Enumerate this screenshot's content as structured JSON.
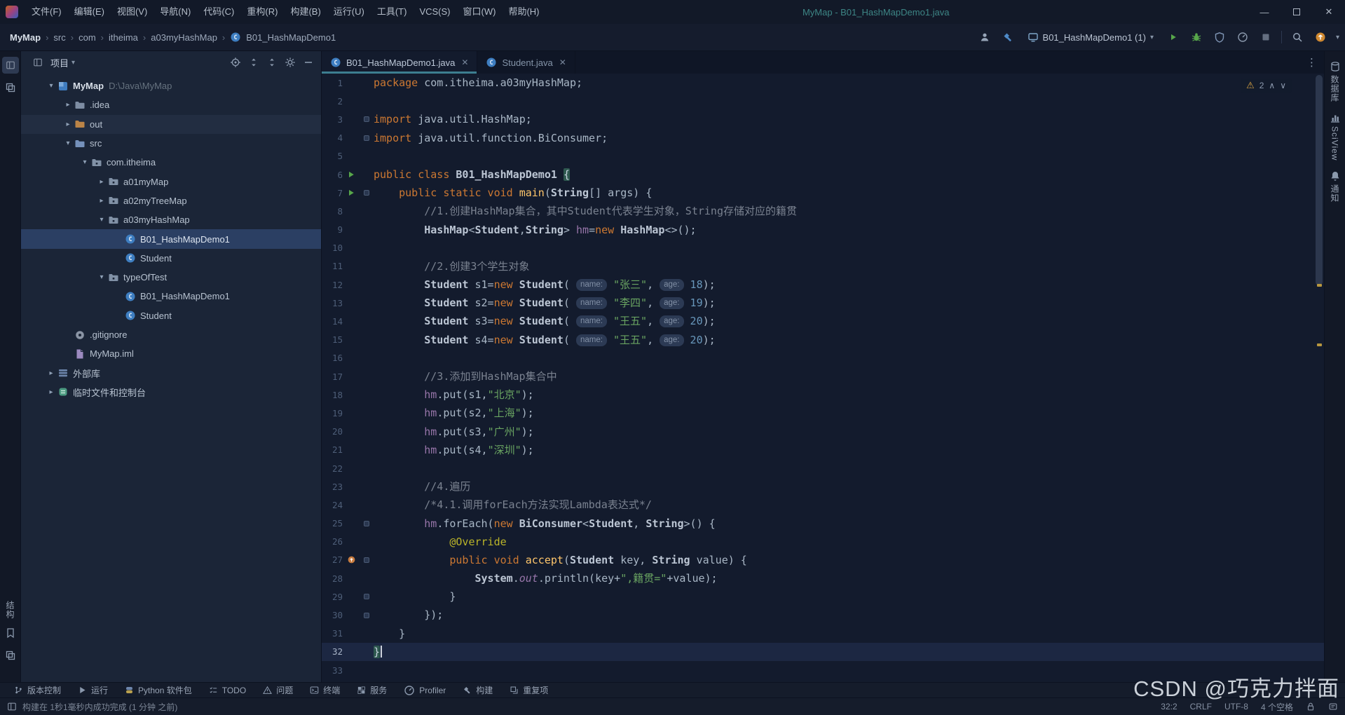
{
  "window": {
    "title": "MyMap - B01_HashMapDemo1.java"
  },
  "menubar": {
    "items": [
      "文件(F)",
      "编辑(E)",
      "视图(V)",
      "导航(N)",
      "代码(C)",
      "重构(R)",
      "构建(B)",
      "运行(U)",
      "工具(T)",
      "VCS(S)",
      "窗口(W)",
      "帮助(H)"
    ]
  },
  "navbar": {
    "breadcrumbs": [
      "MyMap",
      "src",
      "com",
      "itheima",
      "a03myHashMap",
      "B01_HashMapDemo1"
    ],
    "run_config": "B01_HashMapDemo1 (1)"
  },
  "project": {
    "header": "项目",
    "items": [
      {
        "label": "MyMap",
        "suffix": "D:\\Java\\MyMap",
        "level": 0,
        "chev": "open",
        "icon": "project",
        "bold": true
      },
      {
        "label": ".idea",
        "level": 1,
        "chev": "closed",
        "icon": "folder"
      },
      {
        "label": "out",
        "level": 1,
        "chev": "closed",
        "icon": "folder-out",
        "hover": true
      },
      {
        "label": "src",
        "level": 1,
        "chev": "open",
        "icon": "folder-src"
      },
      {
        "label": "com.itheima",
        "level": 2,
        "chev": "open",
        "icon": "package"
      },
      {
        "label": "a01myMap",
        "level": 3,
        "chev": "closed",
        "icon": "package"
      },
      {
        "label": "a02myTreeMap",
        "level": 3,
        "chev": "closed",
        "icon": "package"
      },
      {
        "label": "a03myHashMap",
        "level": 3,
        "chev": "open",
        "icon": "package"
      },
      {
        "label": "B01_HashMapDemo1",
        "level": 4,
        "chev": "none",
        "icon": "class",
        "selected": true
      },
      {
        "label": "Student",
        "level": 4,
        "chev": "none",
        "icon": "class"
      },
      {
        "label": "typeOfTest",
        "level": 3,
        "chev": "open",
        "icon": "package"
      },
      {
        "label": "B01_HashMapDemo1",
        "level": 4,
        "chev": "none",
        "icon": "class"
      },
      {
        "label": "Student",
        "level": 4,
        "chev": "none",
        "icon": "class"
      },
      {
        "label": ".gitignore",
        "level": 1,
        "chev": "none",
        "icon": "git"
      },
      {
        "label": "MyMap.iml",
        "level": 1,
        "chev": "none",
        "icon": "iml"
      },
      {
        "label": "外部库",
        "level": 0,
        "chev": "closed",
        "icon": "libs"
      },
      {
        "label": "临时文件和控制台",
        "level": 0,
        "chev": "closed",
        "icon": "scratch"
      }
    ]
  },
  "tabs": [
    {
      "label": "B01_HashMapDemo1.java",
      "active": true
    },
    {
      "label": "Student.java",
      "active": false
    }
  ],
  "editor": {
    "warning_count": "2",
    "lines": [
      {
        "n": 1,
        "t": [
          [
            "kw",
            "package "
          ],
          [
            "d",
            "com.itheima.a03myHashMap;"
          ]
        ]
      },
      {
        "n": 2,
        "t": []
      },
      {
        "n": 3,
        "fd": 1,
        "t": [
          [
            "kw",
            "import "
          ],
          [
            "d",
            "java.util.HashMap;"
          ]
        ]
      },
      {
        "n": 4,
        "fd": 1,
        "t": [
          [
            "kw",
            "import "
          ],
          [
            "d",
            "java.util.function.BiConsumer;"
          ]
        ]
      },
      {
        "n": 5,
        "t": []
      },
      {
        "n": 6,
        "g": "run",
        "t": [
          [
            "kw",
            "public class "
          ],
          [
            "c",
            "B01_HashMapDemo1 "
          ],
          [
            "bh",
            "{"
          ]
        ]
      },
      {
        "n": 7,
        "g": "run",
        "fd": 1,
        "t": [
          [
            "d",
            "    "
          ],
          [
            "kw",
            "public static void "
          ],
          [
            "fn",
            "main"
          ],
          [
            "d",
            "("
          ],
          [
            "c",
            "String"
          ],
          [
            "d",
            "[] args) {"
          ]
        ]
      },
      {
        "n": 8,
        "t": [
          [
            "d",
            "        "
          ],
          [
            "cm",
            "//1.创建HashMap集合，其中Student代表学生对象，String存储对应的籍贯"
          ]
        ]
      },
      {
        "n": 9,
        "t": [
          [
            "d",
            "        "
          ],
          [
            "c",
            "HashMap"
          ],
          [
            "d",
            "<"
          ],
          [
            "c",
            "Student"
          ],
          [
            "d",
            ","
          ],
          [
            "c",
            "String"
          ],
          [
            "d",
            "> "
          ],
          [
            "f",
            "hm"
          ],
          [
            "d",
            "="
          ],
          [
            "kw",
            "new "
          ],
          [
            "c",
            "HashMap"
          ],
          [
            "d",
            "<>();"
          ]
        ]
      },
      {
        "n": 10,
        "t": []
      },
      {
        "n": 11,
        "t": [
          [
            "d",
            "        "
          ],
          [
            "cm",
            "//2.创建3个学生对象"
          ]
        ]
      },
      {
        "n": 12,
        "t": [
          [
            "d",
            "        "
          ],
          [
            "c",
            "Student"
          ],
          [
            "d",
            " s1="
          ],
          [
            "kw",
            "new "
          ],
          [
            "c",
            "Student"
          ],
          [
            "d",
            "( "
          ],
          [
            "h",
            "name:"
          ],
          [
            "d",
            " "
          ],
          [
            "s",
            "\"张三\""
          ],
          [
            "d",
            ", "
          ],
          [
            "h",
            "age:"
          ],
          [
            "d",
            " "
          ],
          [
            "n",
            "18"
          ],
          [
            "d",
            ");"
          ]
        ]
      },
      {
        "n": 13,
        "t": [
          [
            "d",
            "        "
          ],
          [
            "c",
            "Student"
          ],
          [
            "d",
            " s2="
          ],
          [
            "kw",
            "new "
          ],
          [
            "c",
            "Student"
          ],
          [
            "d",
            "( "
          ],
          [
            "h",
            "name:"
          ],
          [
            "d",
            " "
          ],
          [
            "s",
            "\"李四\""
          ],
          [
            "d",
            ", "
          ],
          [
            "h",
            "age:"
          ],
          [
            "d",
            " "
          ],
          [
            "n",
            "19"
          ],
          [
            "d",
            ");"
          ]
        ]
      },
      {
        "n": 14,
        "t": [
          [
            "d",
            "        "
          ],
          [
            "c",
            "Student"
          ],
          [
            "d",
            " s3="
          ],
          [
            "kw",
            "new "
          ],
          [
            "c",
            "Student"
          ],
          [
            "d",
            "( "
          ],
          [
            "h",
            "name:"
          ],
          [
            "d",
            " "
          ],
          [
            "s",
            "\"王五\""
          ],
          [
            "d",
            ", "
          ],
          [
            "h",
            "age:"
          ],
          [
            "d",
            " "
          ],
          [
            "n",
            "20"
          ],
          [
            "d",
            ");"
          ]
        ]
      },
      {
        "n": 15,
        "t": [
          [
            "d",
            "        "
          ],
          [
            "c",
            "Student"
          ],
          [
            "d",
            " s4="
          ],
          [
            "kw",
            "new "
          ],
          [
            "c",
            "Student"
          ],
          [
            "d",
            "( "
          ],
          [
            "h",
            "name:"
          ],
          [
            "d",
            " "
          ],
          [
            "s",
            "\"王五\""
          ],
          [
            "d",
            ", "
          ],
          [
            "h",
            "age:"
          ],
          [
            "d",
            " "
          ],
          [
            "n",
            "20"
          ],
          [
            "d",
            ");"
          ]
        ]
      },
      {
        "n": 16,
        "t": []
      },
      {
        "n": 17,
        "t": [
          [
            "d",
            "        "
          ],
          [
            "cm",
            "//3.添加到HashMap集合中"
          ]
        ]
      },
      {
        "n": 18,
        "t": [
          [
            "d",
            "        "
          ],
          [
            "f",
            "hm"
          ],
          [
            "d",
            ".put(s1,"
          ],
          [
            "s",
            "\"北京\""
          ],
          [
            "d",
            ");"
          ]
        ]
      },
      {
        "n": 19,
        "t": [
          [
            "d",
            "        "
          ],
          [
            "f",
            "hm"
          ],
          [
            "d",
            ".put(s2,"
          ],
          [
            "s",
            "\"上海\""
          ],
          [
            "d",
            ");"
          ]
        ]
      },
      {
        "n": 20,
        "t": [
          [
            "d",
            "        "
          ],
          [
            "f",
            "hm"
          ],
          [
            "d",
            ".put(s3,"
          ],
          [
            "s",
            "\"广州\""
          ],
          [
            "d",
            ");"
          ]
        ]
      },
      {
        "n": 21,
        "t": [
          [
            "d",
            "        "
          ],
          [
            "f",
            "hm"
          ],
          [
            "d",
            ".put(s4,"
          ],
          [
            "s",
            "\"深圳\""
          ],
          [
            "d",
            ");"
          ]
        ]
      },
      {
        "n": 22,
        "t": []
      },
      {
        "n": 23,
        "t": [
          [
            "d",
            "        "
          ],
          [
            "cm",
            "//4.遍历"
          ]
        ]
      },
      {
        "n": 24,
        "t": [
          [
            "d",
            "        "
          ],
          [
            "cm",
            "/*4.1.调用forEach方法实现Lambda表达式*/"
          ]
        ]
      },
      {
        "n": 25,
        "fd": 1,
        "t": [
          [
            "d",
            "        "
          ],
          [
            "f",
            "hm"
          ],
          [
            "d",
            ".forEach("
          ],
          [
            "kw",
            "new "
          ],
          [
            "c",
            "BiConsumer"
          ],
          [
            "d",
            "<"
          ],
          [
            "c",
            "Student"
          ],
          [
            "d",
            ", "
          ],
          [
            "c",
            "String"
          ],
          [
            "d",
            ">() {"
          ]
        ]
      },
      {
        "n": 26,
        "t": [
          [
            "d",
            "            "
          ],
          [
            "an",
            "@Override"
          ]
        ]
      },
      {
        "n": 27,
        "g": "ovr",
        "fd": 1,
        "t": [
          [
            "d",
            "            "
          ],
          [
            "kw",
            "public void "
          ],
          [
            "fn",
            "accept"
          ],
          [
            "d",
            "("
          ],
          [
            "c",
            "Student"
          ],
          [
            "d",
            " key, "
          ],
          [
            "c",
            "String"
          ],
          [
            "d",
            " value) {"
          ]
        ]
      },
      {
        "n": 28,
        "t": [
          [
            "d",
            "                "
          ],
          [
            "c",
            "System"
          ],
          [
            "d",
            "."
          ],
          [
            "st",
            "out"
          ],
          [
            "d",
            ".println(key+"
          ],
          [
            "s",
            "\",籍贯=\""
          ],
          [
            "d",
            "+value);"
          ]
        ]
      },
      {
        "n": 29,
        "fd": 1,
        "t": [
          [
            "d",
            "            }"
          ]
        ]
      },
      {
        "n": 30,
        "fd": 1,
        "t": [
          [
            "d",
            "        });"
          ]
        ]
      },
      {
        "n": 31,
        "t": [
          [
            "d",
            "    }"
          ]
        ]
      },
      {
        "n": 32,
        "cur": 1,
        "crt": 1,
        "t": [
          [
            "bh",
            "}"
          ]
        ]
      },
      {
        "n": 33,
        "t": []
      }
    ]
  },
  "left_stripe": {
    "bottom_label": "结构"
  },
  "right_stripe": {
    "items": [
      "数据库",
      "SciView",
      "通知"
    ]
  },
  "bottom_toolbar": {
    "items": [
      {
        "icon": "vcs",
        "label": "版本控制"
      },
      {
        "icon": "playg",
        "label": "运行"
      },
      {
        "icon": "python",
        "label": "Python 软件包"
      },
      {
        "icon": "todo",
        "label": "TODO"
      },
      {
        "icon": "problems",
        "label": "问题"
      },
      {
        "icon": "terminal",
        "label": "终端"
      },
      {
        "icon": "services",
        "label": "服务"
      },
      {
        "icon": "gauge",
        "label": "Profiler"
      },
      {
        "icon": "build",
        "label": "构建"
      },
      {
        "icon": "dup",
        "label": "重复项"
      }
    ]
  },
  "statusbar": {
    "message": "构建在 1秒1毫秒内成功完成 (1 分钟 之前)",
    "caret_pos": "32:2",
    "line_ending": "CRLF",
    "encoding": "UTF-8",
    "indent": "4 个空格"
  },
  "watermark": "CSDN @巧克力拌面"
}
